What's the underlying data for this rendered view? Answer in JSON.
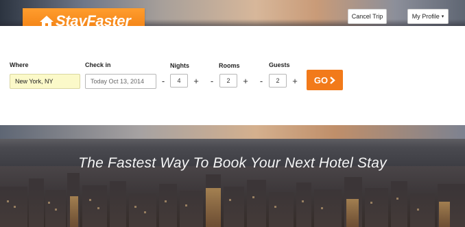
{
  "brand": {
    "logo_text": "StayFaster"
  },
  "header": {
    "cancel_trip_label": "Cancel Trip",
    "my_profile_label": "My Profile"
  },
  "search": {
    "where_label": "Where",
    "where_value": "New York, NY",
    "checkin_label": "Check in",
    "checkin_value": "Today Oct 13, 2014",
    "nights_label": "Nights",
    "nights_value": "4",
    "rooms_label": "Rooms",
    "rooms_value": "2",
    "guests_label": "Guests",
    "guests_value": "2",
    "minus_symbol": "-",
    "plus_symbol": "+",
    "go_label": "GO"
  },
  "hero": {
    "tagline": "The Fastest Way To Book Your Next Hotel Stay"
  },
  "colors": {
    "accent": "#f27a1a",
    "where_field_bg": "#fbf9c9"
  },
  "icons": {
    "logo": "house-icon",
    "go": "chevron-right-icon",
    "profile_caret": "caret-down-icon"
  }
}
